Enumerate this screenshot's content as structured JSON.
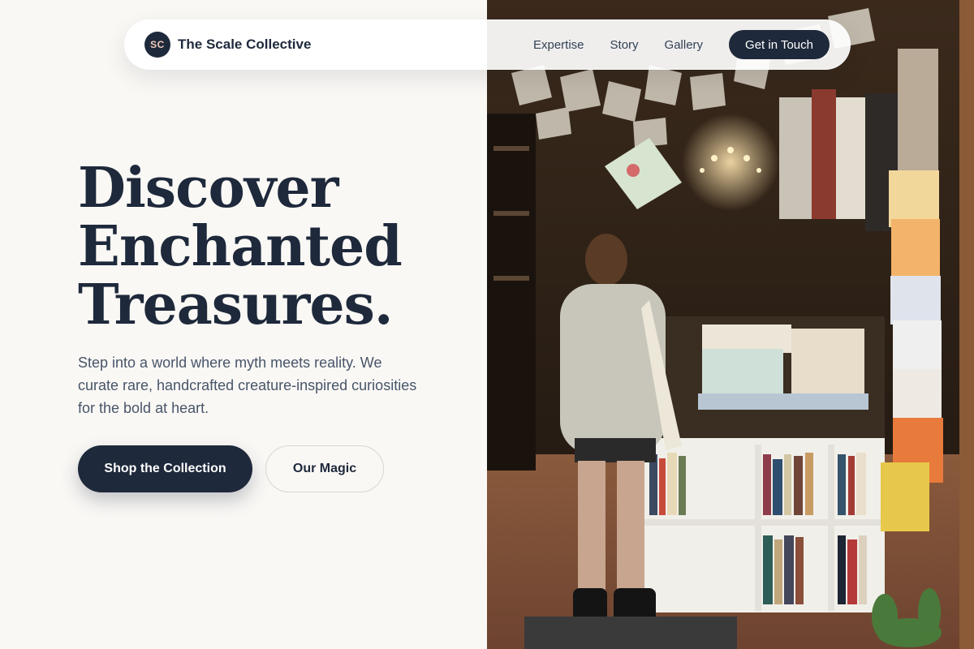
{
  "brand": {
    "initials": "SC",
    "name": "The Scale Collective"
  },
  "nav": {
    "links": [
      "Expertise",
      "Story",
      "Gallery"
    ],
    "cta": "Get in Touch"
  },
  "hero": {
    "title_lines": [
      "Discover",
      "Enchanted",
      "Treasures."
    ],
    "subtitle": "Step into a world where myth meets reality. We curate rare, handcrafted creature-inspired curiosities for the bold at heart.",
    "primary_button": "Shop the Collection",
    "secondary_button": "Our Magic"
  },
  "colors": {
    "page_background": "#faf8f5",
    "navy": "#1e293b",
    "badge_text": "#f1c9b9",
    "muted_text": "#475569"
  },
  "image": {
    "subject": "bookshop-interior-photo"
  }
}
